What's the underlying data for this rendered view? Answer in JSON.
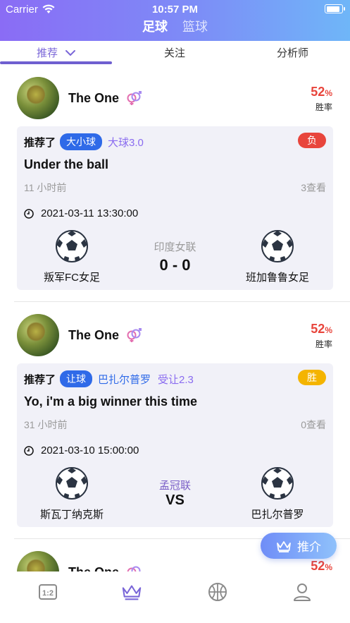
{
  "status_bar": {
    "carrier": "Carrier",
    "time": "10:57 PM",
    "battery_level": 0.9
  },
  "sport_tabs": [
    {
      "label": "足球",
      "active": true
    },
    {
      "label": "篮球",
      "active": false
    }
  ],
  "sub_tabs": [
    {
      "label": "推荐",
      "active": true
    },
    {
      "label": "关注",
      "active": false
    },
    {
      "label": "分析师",
      "active": false
    }
  ],
  "posts": [
    {
      "user": "The One",
      "win_rate": "52",
      "win_rate_unit": "%",
      "win_rate_label": "胜率",
      "recommend_label": "推荐了",
      "market": "大小球",
      "pick_primary": "大球3.0",
      "pick_secondary": "",
      "result": "负",
      "headline": "Under the ball",
      "posted_ago": "11 小时前",
      "views": "3查看",
      "datetime": "2021-03-11 13:30:00",
      "league": "印度女联",
      "score": "0 - 0",
      "home_team": "叛军FC女足",
      "away_team": "班加鲁鲁女足"
    },
    {
      "user": "The One",
      "win_rate": "52",
      "win_rate_unit": "%",
      "win_rate_label": "胜率",
      "recommend_label": "推荐了",
      "market": "让球",
      "pick_primary": "巴扎尔普罗",
      "pick_secondary": "受让2.3",
      "result": "胜",
      "headline": "Yo, i'm a big winner this time",
      "posted_ago": "31 小时前",
      "views": "0查看",
      "datetime": "2021-03-10 15:00:00",
      "league": "孟冠联",
      "score": "VS",
      "home_team": "斯瓦丁纳克斯",
      "away_team": "巴扎尔普罗"
    },
    {
      "user": "The One",
      "win_rate": "52",
      "win_rate_unit": "%"
    }
  ],
  "fab": {
    "label": "推介"
  },
  "bottom_nav": [
    {
      "icon": "scoreboard-icon",
      "active": false
    },
    {
      "icon": "crown-icon",
      "active": true
    },
    {
      "icon": "basketball-icon",
      "active": false
    },
    {
      "icon": "profile-icon",
      "active": false
    }
  ],
  "colors": {
    "header_gradient_start": "#8a6cf5",
    "header_gradient_end": "#6fb6f8",
    "accent_purple": "#7a66d8",
    "pill_blue": "#2f6ae8",
    "lose_red": "#e8453c",
    "win_yellow": "#f4b400"
  }
}
